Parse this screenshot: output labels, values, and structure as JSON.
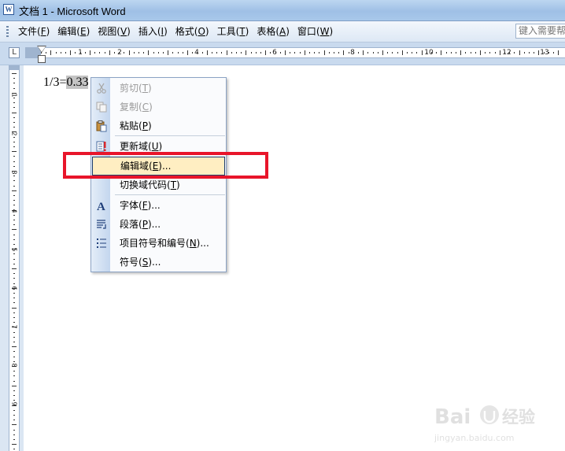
{
  "window": {
    "title": "文档 1 - Microsoft Word",
    "icon": "word-document-icon"
  },
  "menubar": {
    "items": [
      {
        "label": "文件(",
        "key": "F",
        "end": ")"
      },
      {
        "label": "编辑(",
        "key": "E",
        "end": ")"
      },
      {
        "label": "视图(",
        "key": "V",
        "end": ")"
      },
      {
        "label": "插入(",
        "key": "I",
        "end": ")"
      },
      {
        "label": "格式(",
        "key": "O",
        "end": ")"
      },
      {
        "label": "工具(",
        "key": "T",
        "end": ")"
      },
      {
        "label": "表格(",
        "key": "A",
        "end": ")"
      },
      {
        "label": "窗口(",
        "key": "W",
        "end": ")"
      }
    ],
    "help_placeholder": "键入需要帮助的问题"
  },
  "ruler": {
    "corner_label": "L",
    "horizontal_numbers": [
      "1",
      "2",
      "4",
      "6",
      "8",
      "10",
      "12",
      "13"
    ],
    "vertical_numbers": [
      "1",
      "2",
      "3",
      "4",
      "5",
      "6",
      "7",
      "8",
      "9"
    ]
  },
  "document": {
    "text_before": "1/3=",
    "field_text": "0.33"
  },
  "context_menu": {
    "items": [
      {
        "pre": "剪切(",
        "key": "T",
        "post": ")",
        "disabled": true,
        "icon": "scissors-icon"
      },
      {
        "pre": "复制(",
        "key": "C",
        "post": ")",
        "disabled": true,
        "icon": "copy-icon"
      },
      {
        "pre": "粘贴(",
        "key": "P",
        "post": ")",
        "disabled": false,
        "icon": "paste-icon"
      },
      {
        "pre": "更新域(",
        "key": "U",
        "post": ")",
        "disabled": false,
        "icon": "update-field-icon"
      },
      {
        "pre": "编辑域(",
        "key": "E",
        "post": ")...",
        "disabled": false,
        "highlighted": true,
        "icon": ""
      },
      {
        "pre": "切换域代码(",
        "key": "T",
        "post": ")",
        "disabled": false,
        "icon": ""
      },
      {
        "pre": "字体(",
        "key": "F",
        "post": ")...",
        "disabled": false,
        "icon": "font-icon"
      },
      {
        "pre": "段落(",
        "key": "P",
        "post": ")...",
        "disabled": false,
        "icon": "paragraph-icon"
      },
      {
        "pre": "项目符号和编号(",
        "key": "N",
        "post": ")...",
        "disabled": false,
        "icon": "bullets-icon"
      },
      {
        "pre": "符号(",
        "key": "S",
        "post": ")...",
        "disabled": false,
        "icon": ""
      }
    ]
  },
  "annotation": {
    "color": "#e8152a"
  },
  "watermark": {
    "brand": "Bai",
    "brand_cn": "经验",
    "site": "jingyan.baidu.com"
  }
}
